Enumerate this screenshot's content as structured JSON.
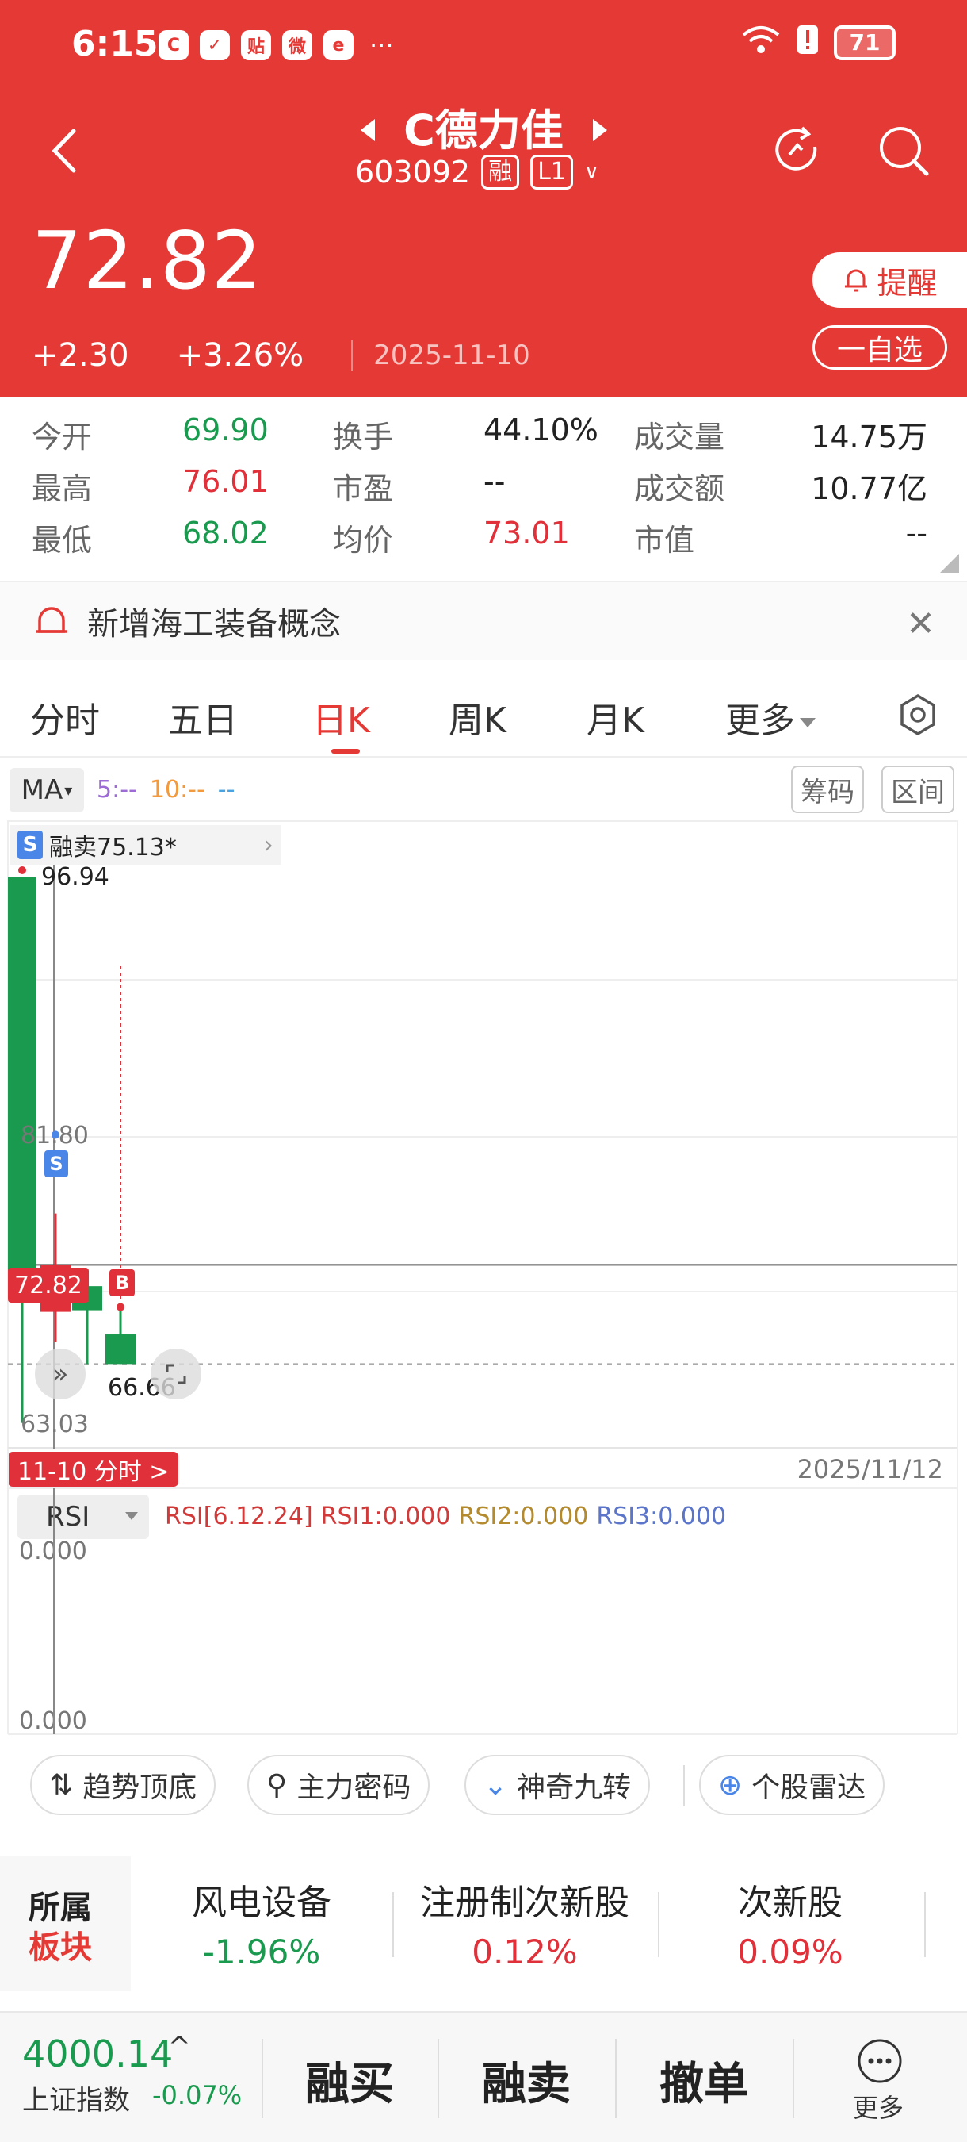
{
  "status": {
    "time": "6:15",
    "apps": [
      "C",
      "✓",
      "贴",
      "微",
      "e"
    ],
    "more": "···",
    "signal": "⁶",
    "battery": "71"
  },
  "header": {
    "name": "C德力佳",
    "code": "603092",
    "tag1": "融",
    "tag2": "L1",
    "price": "72.82",
    "change": "+2.30",
    "change_pct": "+3.26%",
    "date": "2025-11-10",
    "alert_label": "提醒",
    "watch_label": "一自选"
  },
  "quote": {
    "rows": [
      [
        {
          "label": "今开",
          "value": "69.90",
          "color": "green"
        },
        {
          "label": "换手",
          "value": "44.10%",
          "color": "dark"
        },
        {
          "label": "成交量",
          "value": "14.75万",
          "color": "dark"
        }
      ],
      [
        {
          "label": "最高",
          "value": "76.01",
          "color": "red"
        },
        {
          "label": "市盈",
          "value": "--",
          "color": "dark"
        },
        {
          "label": "成交额",
          "value": "10.77亿",
          "color": "dark"
        }
      ],
      [
        {
          "label": "最低",
          "value": "68.02",
          "color": "green"
        },
        {
          "label": "均价",
          "value": "73.01",
          "color": "red"
        },
        {
          "label": "市值",
          "value": "--",
          "color": "dark"
        }
      ]
    ]
  },
  "notice": {
    "text": "新增海工装备概念",
    "close": "✕"
  },
  "tabs": [
    "分时",
    "五日",
    "日K",
    "周K",
    "月K",
    "更多"
  ],
  "active_tab": "日K",
  "chart_controls": {
    "ma_label": "MA",
    "ma5": "5:--",
    "ma10": "10:--",
    "ma20": "--",
    "chip_btn": "筹码",
    "range_btn": "区间",
    "sell_tip": "融卖75.13*",
    "s_badge": "S",
    "b_badge": "B",
    "price_tag": "72.82",
    "high_label": "96.94",
    "low_label": "66.66",
    "date_chip": "11-10 分时 >",
    "date_end": "2025/11/12",
    "rsi_select": "RSI",
    "rsi_main": "RSI[6.12.24]",
    "rsi1": "RSI1:0.000",
    "rsi2": "RSI2:0.000",
    "rsi3": "RSI3:0.000"
  },
  "chart_data": {
    "type": "candlestick",
    "y_ticks": [
      "81.80",
      "63.03"
    ],
    "rsi_ticks": [
      "0.000",
      "0.000"
    ],
    "candles": [
      {
        "open": 96.94,
        "close": 72.0,
        "high": 96.94,
        "low": 63.0,
        "color": "green"
      },
      {
        "open": 69.9,
        "close": 72.82,
        "high": 76.01,
        "low": 68.02,
        "color": "red"
      },
      {
        "open": 71.5,
        "close": 70.0,
        "high": 72.5,
        "low": 66.66,
        "color": "green"
      },
      {
        "open": 68.5,
        "close": 66.66,
        "high": 70.0,
        "low": 66.66,
        "color": "green"
      }
    ],
    "last_price_line": 72.82,
    "low_line": 66.66,
    "grid": true
  },
  "tools": [
    "趋势顶底",
    "主力密码",
    "神奇九转",
    "个股雷达"
  ],
  "sectors": {
    "head1": "所属",
    "head2": "板块",
    "items": [
      {
        "name": "风电设备",
        "pct": "-1.96%",
        "color": "green"
      },
      {
        "name": "注册制次新股",
        "pct": "0.12%",
        "color": "red"
      },
      {
        "name": "次新股",
        "pct": "0.09%",
        "color": "red"
      }
    ]
  },
  "bottom": {
    "index_value": "4000.14",
    "index_arrow": "^",
    "index_name": "上证指数",
    "index_pct": "-0.07%",
    "btn1": "融买",
    "btn2": "融卖",
    "btn3": "撤单",
    "more": "更多"
  },
  "colors": {
    "brand_red": "#e53935",
    "up_red": "#e0313a",
    "down_green": "#1a9a4e"
  }
}
